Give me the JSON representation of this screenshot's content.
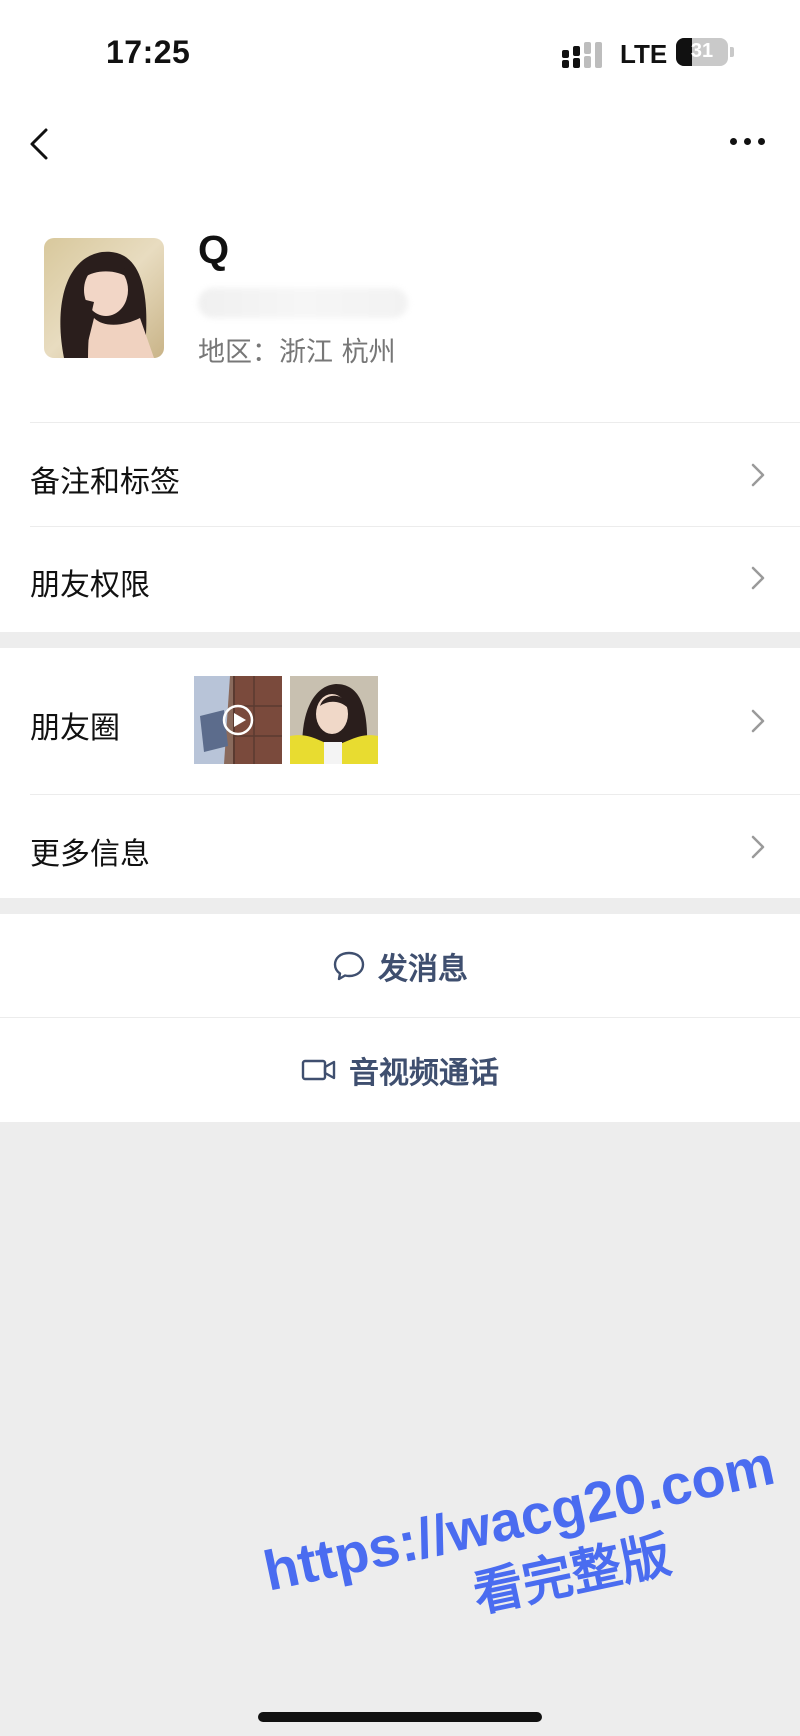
{
  "status_bar": {
    "time": "17:25",
    "network": "LTE",
    "battery": "31",
    "battery_level_percent": 31
  },
  "header": {
    "back_icon": "chevron-left-icon",
    "more_icon": "ellipsis-icon"
  },
  "profile": {
    "name": "Q",
    "region": "地区：浙江 杭州"
  },
  "menu": {
    "notes_tags": "备注和标签",
    "friend_permissions": "朋友权限",
    "moments": "朋友圈",
    "more_info": "更多信息"
  },
  "actions": {
    "send_message": "发消息",
    "video_call": "音视频通话",
    "message_icon": "chat-bubble-icon",
    "video_icon": "video-camera-icon"
  },
  "watermark": {
    "url": "https://wacg20.com",
    "sub": "看完整版"
  },
  "colors": {
    "action_text": "#3f4f6f",
    "watermark": "#4a6cf0",
    "background": "#ededed"
  }
}
